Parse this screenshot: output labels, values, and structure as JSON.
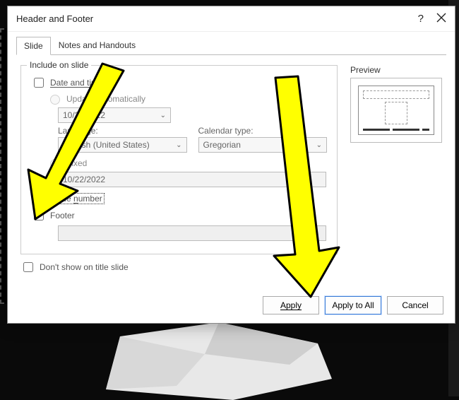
{
  "dialog": {
    "title": "Header and Footer",
    "help": "?",
    "tabs": {
      "slide": "Slide",
      "notes": "Notes and Handouts"
    }
  },
  "include": {
    "legend": "Include on slide",
    "date_time": "Date and time",
    "update_auto": "Update automatically",
    "date_value": "10/22/2022",
    "language_label": "Language:",
    "language_value": "English (United States)",
    "calendar_label": "Calendar type:",
    "calendar_value": "Gregorian",
    "fixed": "Fixed",
    "fixed_value": "10/22/2022",
    "slide_number": "Slide number",
    "footer": "Footer",
    "dont_show": "Don't show on title slide"
  },
  "preview": {
    "label": "Preview"
  },
  "buttons": {
    "apply": "Apply",
    "apply_all": "Apply to All",
    "cancel": "Cancel"
  }
}
